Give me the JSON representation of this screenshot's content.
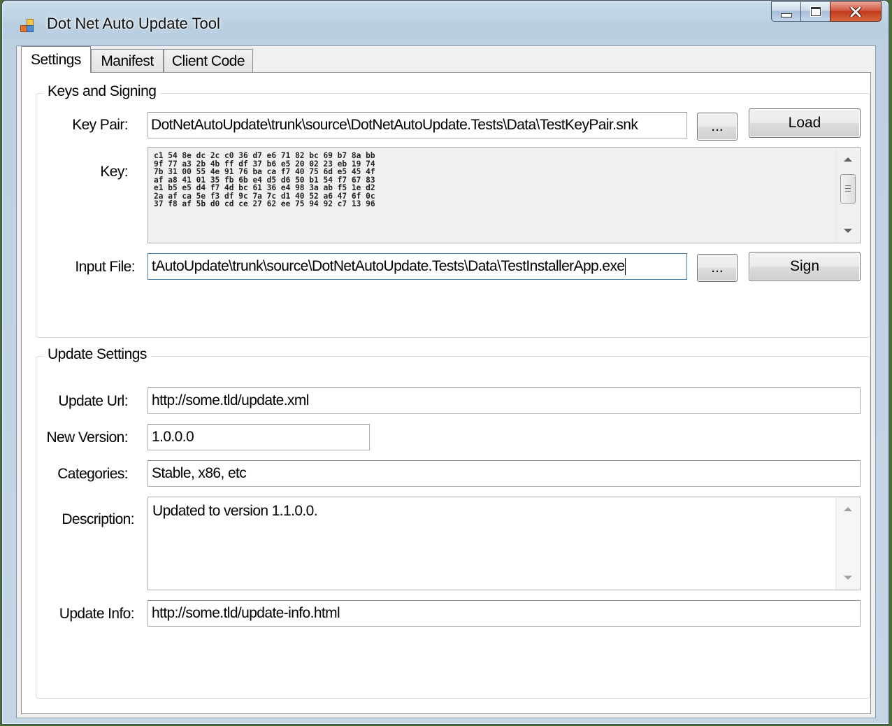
{
  "window": {
    "title": "Dot Net Auto Update Tool",
    "icon": "app-window-icon"
  },
  "tabs": [
    {
      "label": "Settings",
      "active": true
    },
    {
      "label": "Manifest",
      "active": false
    },
    {
      "label": "Client Code",
      "active": false
    }
  ],
  "keys_group": {
    "title": "Keys and Signing",
    "key_pair_label": "Key Pair:",
    "key_pair_value": "DotNetAutoUpdate\\trunk\\source\\DotNetAutoUpdate.Tests\\Data\\TestKeyPair.snk",
    "browse_label": "...",
    "load_label": "Load",
    "key_label": "Key:",
    "key_lines": [
      "c1 54 8e dc 2c c0 36 d7 e6 71 82 bc 69 b7 8a bb",
      "9f 77 a3 2b 4b ff df 37 b6 e5 20 02 23 eb 19 74",
      "7b 31 00 55 4e 91 76 ba ca f7 40 75 6d e5 45 4f",
      "af a8 41 01 35 fb 6b e4 d5 d6 50 b1 54 f7 67 83",
      "e1 b5 e5 d4 f7 4d bc 61 36 e4 98 3a ab f5 1e d2",
      "2a af ca 5e f3 df 9c 7a 7c d1 40 52 a6 47 6f 0c",
      "37 f8 af 5b d0 cd ce 27 62 ee 75 94 92 c7 13 96"
    ],
    "input_file_label": "Input File:",
    "input_file_value": "tAutoUpdate\\trunk\\source\\DotNetAutoUpdate.Tests\\Data\\TestInstallerApp.exe",
    "browse2_label": "...",
    "sign_label": "Sign"
  },
  "update_group": {
    "title": "Update Settings",
    "update_url_label": "Update Url:",
    "update_url_value": "http://some.tld/update.xml",
    "new_version_label": "New Version:",
    "new_version_value": "1.0.0.0",
    "categories_label": "Categories:",
    "categories_value": "Stable, x86, etc",
    "description_label": "Description:",
    "description_value": "Updated to version 1.1.0.0.",
    "update_info_label": "Update Info:",
    "update_info_value": "http://some.tld/update-info.html"
  }
}
